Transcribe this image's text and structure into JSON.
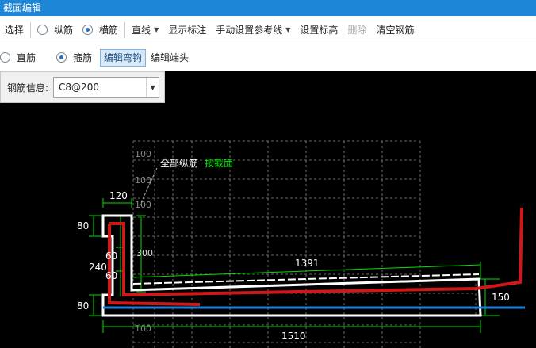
{
  "window": {
    "title": "截面编辑"
  },
  "toolbar": {
    "select": "选择",
    "longitudinal": "纵筋",
    "transverse": "横筋",
    "line": "直线",
    "show_dims": "显示标注",
    "manual_ref": "手动设置参考线",
    "set_elev": "设置标高",
    "delete": "删除",
    "clear": "清空钢筋"
  },
  "toolbar2": {
    "straight": "直筋",
    "stirrup": "箍筋",
    "edit_hook": "编辑弯钩",
    "edit_end": "编辑端头"
  },
  "info": {
    "label": "钢筋信息:",
    "value": "C8@200"
  },
  "canvas": {
    "note_white": "全部纵筋",
    "note_green": "按截面",
    "grid_labels": [
      "100",
      "100",
      "100",
      "300",
      "100"
    ],
    "dims": {
      "top_width": "120",
      "left_upper": "80",
      "left_lower": "80",
      "height_total": "240",
      "seg1": "60",
      "seg2": "60",
      "slope_len": "1391",
      "right_height": "150",
      "bottom_len": "1510"
    }
  },
  "colors": {
    "title_bar": "#1e86d6",
    "dim_green": "#00e000",
    "rebar_red": "#d01818",
    "ref_blue": "#1e7fd8",
    "outline": "#ffffff"
  }
}
